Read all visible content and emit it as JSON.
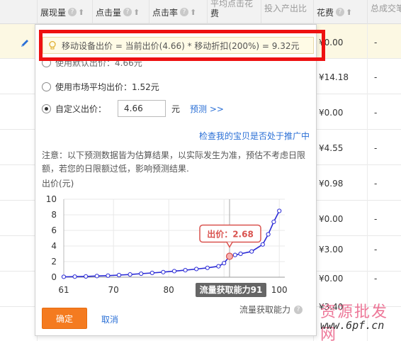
{
  "table": {
    "headers": [
      {
        "label": "展现量",
        "sub": ""
      },
      {
        "label": "点击量",
        "sub": ""
      },
      {
        "label": "点击率",
        "sub": ""
      },
      {
        "label": "费",
        "sub": "平均点击花"
      },
      {
        "label": "投入产出比",
        "sub": ""
      },
      {
        "label": "花费",
        "sub": ""
      },
      {
        "label": "总成交笔",
        "sub": ""
      }
    ],
    "spend": [
      "¥0.00",
      "¥14.18",
      "¥0.00",
      "¥4.55",
      "¥0.98",
      "¥0.00",
      "¥3.00",
      "¥0.00",
      "¥3.40"
    ],
    "dash": "-"
  },
  "popup": {
    "tip": "移动设备出价 = 当前出价(4.66) * 移动折扣(200%) = 9.32元",
    "option_partial": "使用默认出价：4.66元",
    "option_market": "使用市场平均出价：1.52元",
    "option_custom": "自定义出价：",
    "bid_value": "4.66",
    "unit": "元",
    "predict_link": "预测 >>",
    "check_link": "检查我的宝贝是否处于推广中",
    "notice": "注意：以下预测数据皆为估算结果，以实际发生为准，预估不考虑日限额，若您的日限额过低，影响预测结果.",
    "y_title": "出价(元)",
    "x_title": "流量获取能力",
    "confirm": "确定",
    "cancel": "取消"
  },
  "chart_data": {
    "type": "line",
    "xlabel": "流量获取能力",
    "ylabel": "出价(元)",
    "xlim": [
      61,
      101
    ],
    "ylim": [
      0,
      10
    ],
    "x_ticks": [
      61,
      70,
      80,
      90,
      100
    ],
    "y_ticks": [
      0,
      2,
      4,
      6,
      8,
      10
    ],
    "series": [
      {
        "x": [
          61,
          63,
          65,
          67,
          69,
          71,
          73,
          75,
          77,
          79,
          81,
          83,
          85,
          87,
          89,
          90,
          91,
          92,
          93,
          95,
          97,
          98,
          99,
          100
        ],
        "y": [
          0.05,
          0.07,
          0.1,
          0.15,
          0.2,
          0.27,
          0.35,
          0.45,
          0.55,
          0.65,
          0.78,
          0.9,
          1.05,
          1.2,
          1.4,
          1.8,
          2.68,
          2.85,
          3.0,
          3.3,
          4.2,
          5.5,
          7.1,
          8.5
        ]
      }
    ],
    "highlight": {
      "x": 91,
      "y": 2.68,
      "label": "出价：2.68",
      "x_label": "流量获取能力91"
    },
    "colors": {
      "line": "#2b2bd6",
      "marker_fill": "#ffffff",
      "highlight": "#d9534f",
      "grid": "#e8e8e8"
    }
  },
  "watermark": {
    "text": "资源批发网",
    "url": "www.6pf.cn"
  }
}
